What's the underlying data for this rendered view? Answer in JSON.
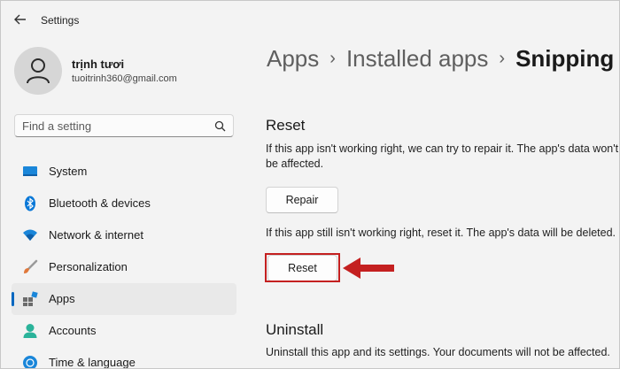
{
  "window": {
    "title": "Settings"
  },
  "user": {
    "name": "trịnh tươi",
    "email": "tuoitrinh360@gmail.com"
  },
  "search": {
    "placeholder": "Find a setting"
  },
  "sidebar": {
    "items": [
      {
        "label": "System",
        "icon": "monitor-icon"
      },
      {
        "label": "Bluetooth & devices",
        "icon": "bluetooth-icon"
      },
      {
        "label": "Network & internet",
        "icon": "wifi-icon"
      },
      {
        "label": "Personalization",
        "icon": "brush-icon"
      },
      {
        "label": "Apps",
        "icon": "apps-icon",
        "active": true
      },
      {
        "label": "Accounts",
        "icon": "person-icon"
      },
      {
        "label": "Time & language",
        "icon": "globe-clock-icon"
      }
    ]
  },
  "breadcrumb": {
    "items": [
      "Apps",
      "Installed apps",
      "Snipping T"
    ]
  },
  "reset": {
    "title": "Reset",
    "repair_desc": "If this app isn't working right, we can try to repair it. The app's data won't be affected.",
    "repair_button": "Repair",
    "reset_desc": "If this app still isn't working right, reset it. The app's data will be deleted.",
    "reset_button": "Reset"
  },
  "uninstall": {
    "title": "Uninstall",
    "desc": "Uninstall this app and its settings. Your documents will not be affected."
  },
  "colors": {
    "accent": "#0067c0",
    "annotation": "#c42020"
  }
}
